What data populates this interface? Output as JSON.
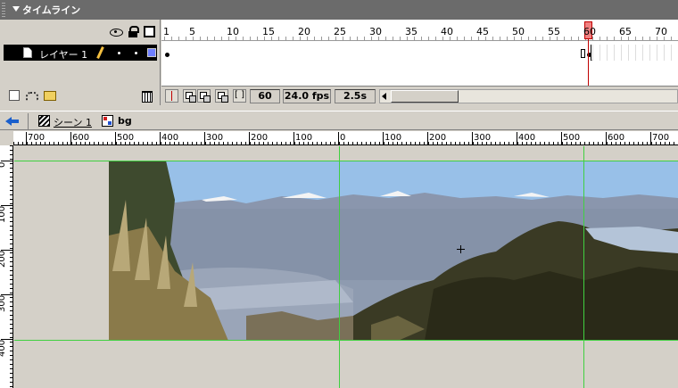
{
  "timeline": {
    "title": "タイムライン",
    "layer": {
      "name": "レイヤー 1",
      "outline_color": "#6f7fff"
    },
    "frame_numbers": [
      "1",
      "5",
      "10",
      "15",
      "20",
      "25",
      "30",
      "35",
      "40",
      "45",
      "50",
      "55",
      "60",
      "65",
      "70"
    ],
    "status": {
      "current_frame": "60",
      "fps": "24.0 fps",
      "elapsed": "2.5s"
    },
    "playhead_color": "#f08080"
  },
  "breadcrumb": {
    "scene": "シーン 1",
    "symbol": "bg"
  },
  "ruler": {
    "top": [
      "700",
      "600",
      "500",
      "400",
      "300",
      "200",
      "100",
      "0",
      "100",
      "200",
      "300",
      "400",
      "500",
      "600",
      "700"
    ],
    "left": [
      "0",
      "100",
      "200",
      "300",
      "400"
    ]
  },
  "stage": {
    "guide_color": "#40d040",
    "background": "#d4d0c8"
  }
}
